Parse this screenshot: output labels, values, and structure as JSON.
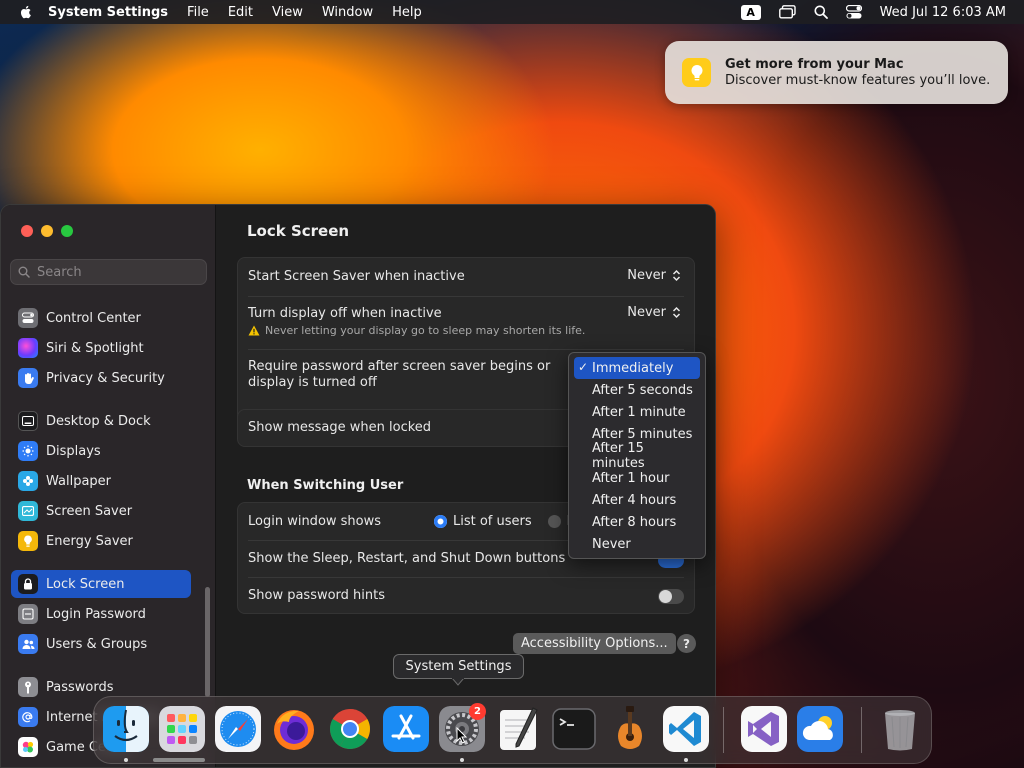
{
  "menubar": {
    "app_name": "System Settings",
    "items": [
      "File",
      "Edit",
      "View",
      "Window",
      "Help"
    ],
    "input_source": "A",
    "clock": "Wed Jul 12  6:03 AM"
  },
  "notification": {
    "title": "Get more from your Mac",
    "body": "Discover must-know features you’ll love."
  },
  "sidebar": {
    "search_placeholder": "Search",
    "items": [
      {
        "label": "Control Center",
        "icon": "control-center-icon",
        "color": "#6e6e73"
      },
      {
        "label": "Siri & Spotlight",
        "icon": "siri-icon",
        "color": "#8e44ff"
      },
      {
        "label": "Privacy & Security",
        "icon": "hand-icon",
        "color": "#3a7bf0"
      },
      {
        "label": "Desktop & Dock",
        "icon": "desktop-dock-icon",
        "color": "#1c1c1e"
      },
      {
        "label": "Displays",
        "icon": "displays-icon",
        "color": "#2f7cf6"
      },
      {
        "label": "Wallpaper",
        "icon": "wallpaper-icon",
        "color": "#2aa8e6"
      },
      {
        "label": "Screen Saver",
        "icon": "screen-saver-icon",
        "color": "#30b8d8"
      },
      {
        "label": "Energy Saver",
        "icon": "energy-saver-icon",
        "color": "#f5b80a"
      },
      {
        "label": "Lock Screen",
        "icon": "lock-icon",
        "color": "#1c1c1e"
      },
      {
        "label": "Login Password",
        "icon": "login-password-icon",
        "color": "#7d7d82"
      },
      {
        "label": "Users & Groups",
        "icon": "users-groups-icon",
        "color": "#3a7bf0"
      },
      {
        "label": "Passwords",
        "icon": "key-icon",
        "color": "#8e8e93"
      },
      {
        "label": "Internet Accounts",
        "icon": "at-icon",
        "color": "#3a7bf0"
      },
      {
        "label": "Game Center",
        "icon": "game-center-icon",
        "color": "#ffffff"
      }
    ]
  },
  "content": {
    "title": "Lock Screen",
    "screen_saver": {
      "label": "Start Screen Saver when inactive",
      "value": "Never"
    },
    "display_off": {
      "label": "Turn display off when inactive",
      "value": "Never",
      "warning": "Never letting your display go to sleep may shorten its life."
    },
    "require_password": {
      "label_line1": "Require password after screen saver begins or",
      "label_line2": "display is turned off"
    },
    "show_message": {
      "label": "Show message when locked"
    },
    "switching_title": "When Switching User",
    "login_window": {
      "label": "Login window shows",
      "option1": "List of users",
      "option2": "N"
    },
    "sleep_buttons": {
      "label": "Show the Sleep, Restart, and Shut Down buttons"
    },
    "password_hints": {
      "label": "Show password hints"
    },
    "accessibility_button": "Accessibility Options...",
    "help": "?"
  },
  "dropdown": {
    "check": "✓",
    "options": [
      "Immediately",
      "After 5 seconds",
      "After 1 minute",
      "After 5 minutes",
      "After 15 minutes",
      "After 1 hour",
      "After 4 hours",
      "After 8 hours",
      "Never"
    ],
    "selected": "Immediately"
  },
  "tooltip": "System Settings",
  "dock": {
    "badge": "2",
    "apps": [
      "finder-icon",
      "launchpad-icon",
      "safari-icon",
      "firefox-icon",
      "chrome-icon",
      "app-store-icon",
      "system-settings-icon",
      "textedit-icon",
      "terminal-icon",
      "garageband-icon",
      "vscode-icon",
      "visual-studio-icon",
      "weather-icon",
      "trash-icon"
    ]
  },
  "colors": {
    "accent": "#1e55c4",
    "warning": "#f5c400"
  }
}
